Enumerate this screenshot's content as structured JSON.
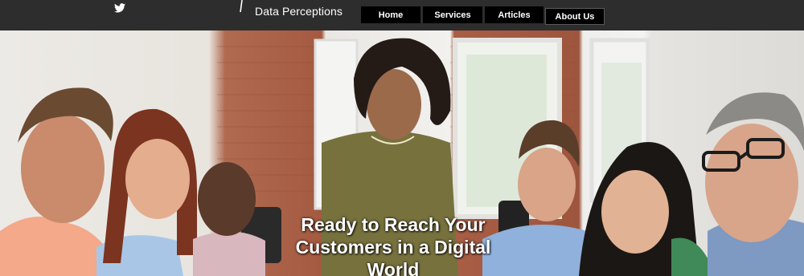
{
  "header": {
    "brand": "Data Perceptions",
    "social_icon": "twitter-icon",
    "nav": [
      {
        "label": "Home"
      },
      {
        "label": "Services"
      },
      {
        "label": "Articles"
      },
      {
        "label": "About Us"
      }
    ]
  },
  "hero": {
    "title_line1": "Ready to Reach Your",
    "title_line2": "Customers in a Digital",
    "title_line3": "World"
  },
  "colors": {
    "topbar": "#2d2d2d",
    "nav_button": "#000000",
    "text": "#ffffff"
  }
}
